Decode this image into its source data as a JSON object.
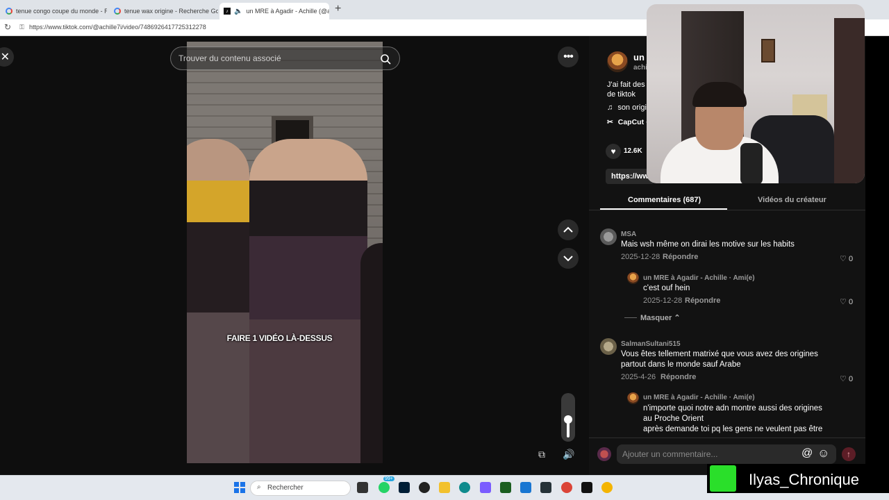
{
  "browser": {
    "tabs": [
      {
        "title": "tenue congo coupe du monde - R",
        "icon": "google-icon",
        "active": false
      },
      {
        "title": "tenue wax origine - Recherche Go",
        "icon": "google-icon",
        "active": false
      },
      {
        "title": "un MRE à Agadir - Achille (@a",
        "icon": "tiktok-icon",
        "active": true
      }
    ],
    "new_tab": "+",
    "url": "https://www.tiktok.com/@achille7i/video/7486926417725312278"
  },
  "player": {
    "search_placeholder": "Trouver du contenu associé",
    "caption": "FAIRE 1 VIDÉO LÀ-DESSUS",
    "volume_level": 0.45
  },
  "author": {
    "name": "un",
    "handle": "achi",
    "description": "J'ai fait des r\nde tiktok",
    "music": "son origi",
    "capcut": "CapCut ·",
    "likes": "12.6K",
    "link": "https://www..."
  },
  "tabs": {
    "comments": "Commentaires (687)",
    "creator_videos": "Vidéos du créateur"
  },
  "comments": [
    {
      "user": "MSA",
      "text": "Mais wsh même on dirai les motive sur les habits",
      "date": "2025-12-28",
      "reply": "Répondre",
      "likes": "0",
      "replies": [
        {
          "user": "un MRE à Agadir - Achille · Ami(e)",
          "text": "c'est ouf hein",
          "date": "2025-12-28",
          "reply": "Répondre",
          "likes": "0"
        }
      ],
      "hide": "Masquer"
    },
    {
      "user": "SalmanSultani515",
      "text_lines": [
        "Vous êtes tellement matrixé que vous avez des origines",
        "partout dans le monde sauf Arabe"
      ],
      "date": "2025-4-26",
      "reply": "Répondre",
      "likes": "0",
      "replies": [
        {
          "user": "un MRE à Agadir - Achille · Ami(e)",
          "text_lines": [
            "n'importe quoi notre adn montre aussi des origines",
            "au Proche Orient",
            "après demande toi pq les gens ne veulent pas être"
          ]
        }
      ]
    }
  ],
  "composer": {
    "placeholder": "Ajouter un commentaire...",
    "at": "@",
    "emoji": "☺",
    "send": "↑"
  },
  "taskbar": {
    "search_label": "Rechercher",
    "badge": "99+"
  },
  "streamer": {
    "name": "Ilyas_Chronique"
  }
}
